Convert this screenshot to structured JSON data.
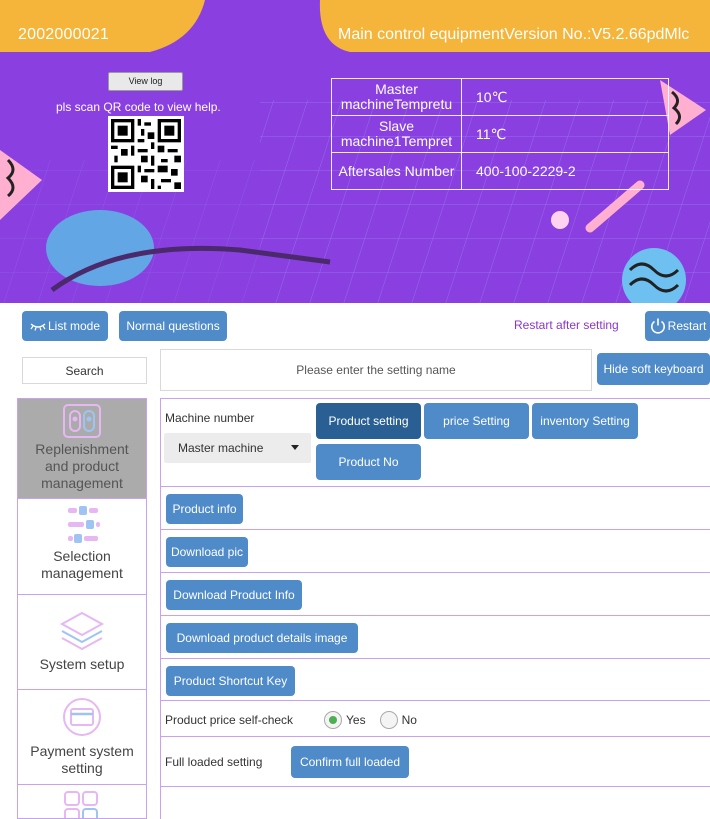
{
  "header": {
    "device_id": "2002000021",
    "version": "Main control equipmentVersion No.:V5.2.66pdMlc",
    "view_log": "View log",
    "qr_hint": "pls scan QR code to view help."
  },
  "info_table": [
    {
      "key": "Master machineTempretu",
      "value": "10℃"
    },
    {
      "key": "Slave machine1Tempret",
      "value": "11℃"
    },
    {
      "key": "Aftersales Number",
      "value": "400-100-2229-2"
    }
  ],
  "toolbar": {
    "list_mode": "List mode",
    "normal_questions": "Normal questions",
    "restart_hint": "Restart after setting",
    "restart": "Restart"
  },
  "search": {
    "label": "Search",
    "placeholder": "Please enter the setting name",
    "hide_keyboard": "Hide soft keyboard"
  },
  "sidebar": {
    "items": [
      {
        "label": "Replenishment and product management",
        "icon": "product-icon",
        "active": true
      },
      {
        "label": "Selection management",
        "icon": "selection-icon"
      },
      {
        "label": "System setup",
        "icon": "layers-icon"
      },
      {
        "label": "Payment system setting",
        "icon": "card-icon"
      }
    ]
  },
  "main": {
    "machine_label": "Machine number",
    "machine_select": "Master machine",
    "tabs": {
      "product_setting": "Product setting",
      "price_setting": "price Setting",
      "inventory_setting": "inventory Setting",
      "product_no": "Product No"
    },
    "buttons": {
      "product_info": "Product info",
      "download_pic": "Download pic",
      "download_product_info": "Download Product Info",
      "download_details_image": "Download product details image",
      "shortcut_key": "Product Shortcut Key",
      "confirm_full_loaded": "Confirm full loaded"
    },
    "price_check": {
      "label": "Product price self-check",
      "yes": "Yes",
      "no": "No",
      "selected": "Yes"
    },
    "full_loaded_label": "Full loaded setting"
  },
  "colors": {
    "banner": "#8a3fe0",
    "button": "#4f8bc9",
    "button_active": "#2a5f94",
    "accent_text": "#8e35c9",
    "divider": "#c9a2ef"
  }
}
